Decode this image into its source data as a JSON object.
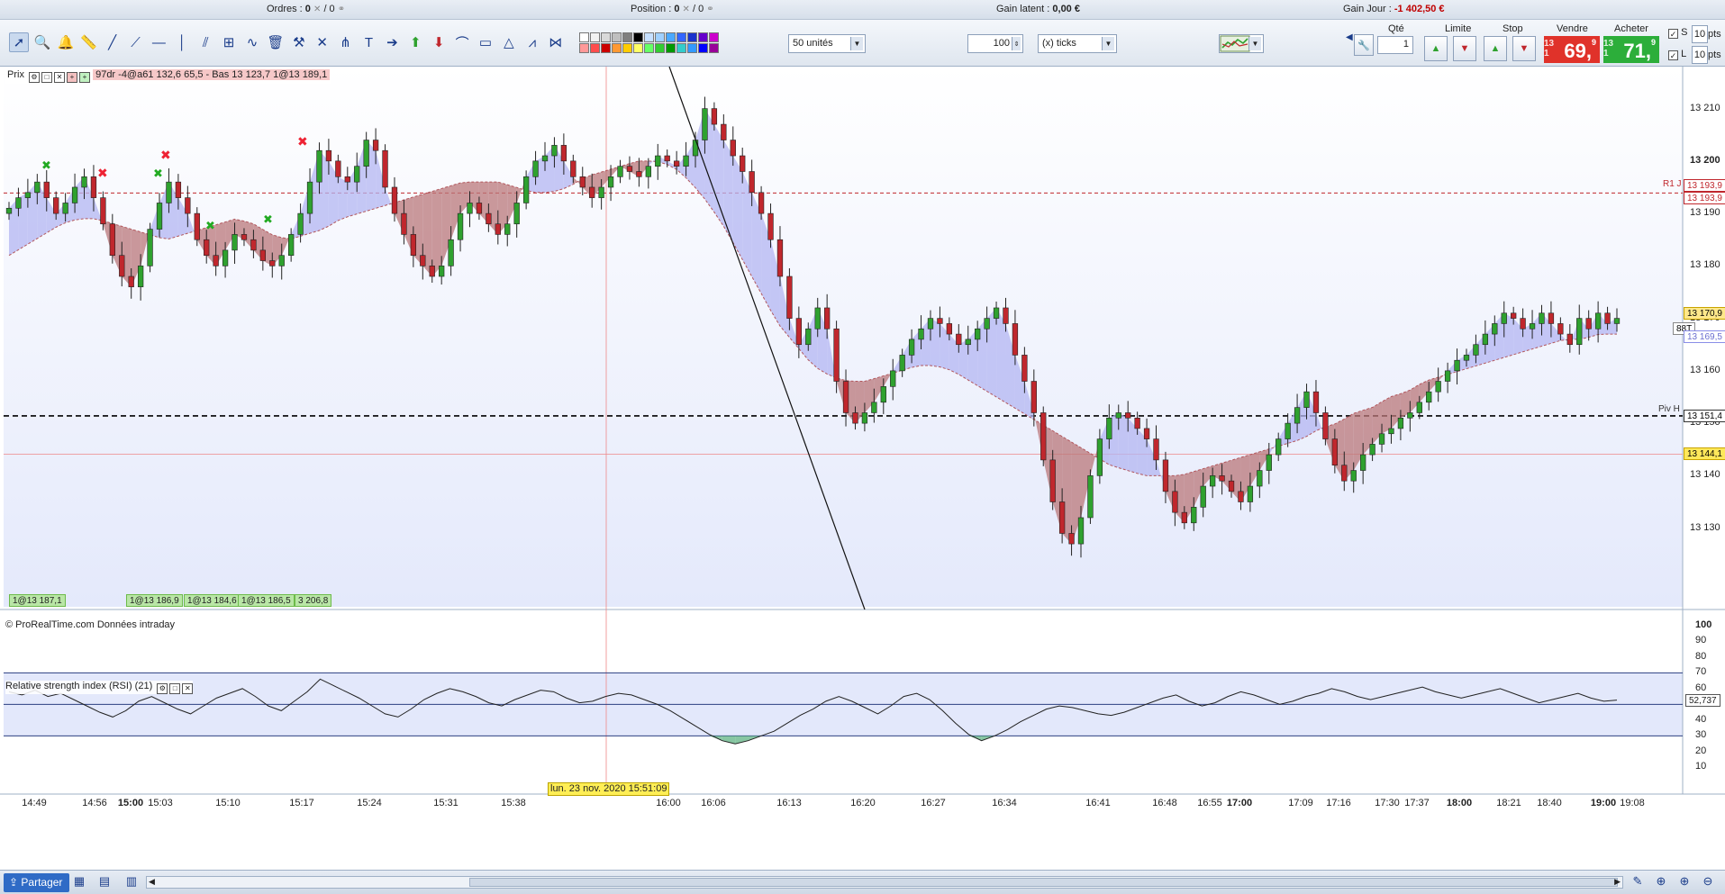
{
  "status": {
    "orders_label": "Ordres :",
    "orders_val1": "0",
    "orders_val2": "/ 0",
    "position_label": "Position :",
    "position_val1": "0",
    "position_val2": "/ 0",
    "gain_latent_label": "Gain latent :",
    "gain_latent_val": "0,00 €",
    "gain_jour_label": "Gain Jour :",
    "gain_jour_val": "-1 402,50 €"
  },
  "toolbar": {
    "units_select": "50 unités",
    "ticks_value": "100",
    "ticks_select": "(x) ticks",
    "tools": [
      "pointer-icon",
      "zoom-icon",
      "alert-bell-icon",
      "ruler-icon",
      "trendline-icon",
      "ray-icon",
      "horizontal-line-icon",
      "vertical-line-icon",
      "parallel-channel-icon",
      "fibonacci-icon",
      "wave-icon",
      "trash-icon",
      "hammer-icon",
      "cross-line-icon",
      "andrews-fork-icon",
      "text-icon",
      "arrow-right-icon",
      "arrow-up-icon",
      "arrow-down-icon",
      "polyline-icon",
      "rectangle-icon",
      "triangle-icon",
      "gann-icon",
      "pattern-icon"
    ]
  },
  "order_panel": {
    "qty_label": "Qté",
    "qty_value": "1",
    "limit_label": "Limite",
    "stop_label": "Stop",
    "sell_label": "Vendre",
    "buy_label": "Acheter",
    "sell_small": "13 1",
    "sell_big": "69,",
    "sell_sup": "9",
    "buy_small": "13 1",
    "buy_big": "71,",
    "buy_sup": "9",
    "s_label": "S",
    "l_label": "L",
    "s_pts": "10",
    "l_pts": "10",
    "pts_unit": "pts"
  },
  "price_panel": {
    "label": "Prix",
    "info": "97dr  -4@a61 132,6 65,5 - Bas 13 123,7 1@13 189,1",
    "watermark": "© ProRealTime.com Données intraday",
    "bottom_tags": [
      "1@13 187,1",
      "1@13 186,9",
      "1@13 184,6",
      "1@13 186,5",
      "3 206,8"
    ],
    "r1_label": "R1 J",
    "piv_label": "Piv H",
    "price_tags": [
      "13 193,9",
      "13 193,9",
      "13 170,9",
      "88T",
      "13 169,5",
      "13 151,4",
      "13 144,1"
    ]
  },
  "rsi_panel": {
    "label": "Relative strength index (RSI) (21)",
    "current": "52,737"
  },
  "colors": {
    "up_candle": "#2fa12f",
    "down_candle": "#c0272d",
    "cloud_red": "#b9777a",
    "cloud_blue": "#b3b5f1",
    "sell_bg": "#e0322a",
    "buy_bg": "#2cae3a",
    "pivot_line": "#000000",
    "r1_line": "#c0272d"
  },
  "cursor_date": "lun. 23 nov. 2020 15:51:09",
  "bottombar": {
    "share": "Partager"
  },
  "chart_data": {
    "type": "candlestick",
    "instrument_unit": "points",
    "price_axis": {
      "ylim": [
        13115,
        13218
      ],
      "ticks": [
        "13 210",
        "13 200",
        "13 190",
        "13 180",
        "13 170",
        "13 160",
        "13 150",
        "13 140",
        "13 130"
      ],
      "bold_ticks": [
        "13 200"
      ]
    },
    "rsi_axis": {
      "ylim": [
        0,
        105
      ],
      "ticks": [
        "100",
        "90",
        "80",
        "70",
        "60",
        "50",
        "40",
        "30",
        "20",
        "10"
      ],
      "bold_ticks": [
        "100"
      ],
      "levels": [
        70,
        50,
        30
      ]
    },
    "x_axis": {
      "ticks": [
        "14:49",
        "14:56",
        "15:00",
        "15:03",
        "15:10",
        "15:17",
        "15:24",
        "15:31",
        "15:38",
        "16:00",
        "16:06",
        "16:13",
        "16:20",
        "16:27",
        "16:34",
        "16:41",
        "16:48",
        "16:55",
        "17:00",
        "17:09",
        "17:16",
        "17:30",
        "17:37",
        "18:00",
        "18:21",
        "18:40",
        "19:00",
        "19:08"
      ],
      "bold_ticks": [
        "15:00",
        "17:00",
        "18:00",
        "19:00"
      ]
    },
    "close_path": [
      13191,
      13193,
      13194,
      13196,
      13193,
      13190,
      13192,
      13195,
      13197,
      13193,
      13188,
      13182,
      13178,
      13176,
      13180,
      13187,
      13192,
      13196,
      13193,
      13190,
      13185,
      13182,
      13180,
      13183,
      13186,
      13185,
      13183,
      13181,
      13180,
      13182,
      13186,
      13190,
      13196,
      13202,
      13200,
      13197,
      13196,
      13199,
      13204,
      13202,
      13195,
      13190,
      13186,
      13182,
      13180,
      13178,
      13180,
      13185,
      13190,
      13192,
      13190,
      13188,
      13186,
      13188,
      13192,
      13197,
      13200,
      13201,
      13203,
      13200,
      13197,
      13195,
      13193,
      13195,
      13197,
      13199,
      13198,
      13197,
      13199,
      13201,
      13200,
      13199,
      13201,
      13204,
      13210,
      13207,
      13204,
      13201,
      13198,
      13194,
      13190,
      13185,
      13178,
      13170,
      13165,
      13168,
      13172,
      13168,
      13158,
      13152,
      13150,
      13152,
      13154,
      13157,
      13160,
      13163,
      13166,
      13168,
      13170,
      13169,
      13167,
      13165,
      13166,
      13168,
      13170,
      13172,
      13169,
      13163,
      13158,
      13152,
      13143,
      13135,
      13129,
      13127,
      13132,
      13140,
      13147,
      13151,
      13152,
      13151,
      13149,
      13147,
      13143,
      13137,
      13133,
      13131,
      13134,
      13138,
      13140,
      13139,
      13137,
      13135,
      13138,
      13141,
      13144,
      13147,
      13150,
      13153,
      13156,
      13152,
      13147,
      13142,
      13139,
      13141,
      13144,
      13146,
      13148,
      13149,
      13151,
      13152,
      13154,
      13156,
      13158,
      13160,
      13162,
      13163,
      13165,
      13167,
      13169,
      13171,
      13170,
      13168,
      13169,
      13171,
      13169,
      13167,
      13165,
      13170,
      13168,
      13171,
      13169,
      13170
    ],
    "mavg_path": [
      13182,
      13184,
      13186,
      13188,
      13189,
      13189,
      13188,
      13187,
      13186,
      13185,
      13186,
      13187,
      13188,
      13189,
      13188,
      13186,
      13185,
      13186,
      13187,
      13189,
      13190,
      13191,
      13192,
      13193,
      13194,
      13195,
      13196,
      13196,
      13196,
      13195,
      13194,
      13194,
      13195,
      13197,
      13198,
      13199,
      13200,
      13200,
      13199,
      13196,
      13192,
      13187,
      13181,
      13175,
      13169,
      13165,
      13161,
      13159,
      13158,
      13158,
      13159,
      13160,
      13161,
      13161,
      13160,
      13158,
      13156,
      13154,
      13152,
      13150,
      13148,
      13146,
      13144,
      13142,
      13141,
      13140,
      13140,
      13140,
      13141,
      13142,
      13143,
      13144,
      13145,
      13146,
      13147,
      13149,
      13150,
      13152,
      13153,
      13155,
      13156,
      13158,
      13159,
      13160,
      13161,
      13162,
      13163,
      13164,
      13165,
      13166,
      13166,
      13167,
      13167
    ],
    "rsi_path": [
      58,
      56,
      59,
      55,
      57,
      53,
      49,
      45,
      42,
      46,
      52,
      55,
      51,
      47,
      44,
      49,
      54,
      57,
      60,
      55,
      49,
      46,
      52,
      58,
      66,
      62,
      58,
      54,
      49,
      44,
      42,
      47,
      53,
      57,
      60,
      58,
      55,
      51,
      49,
      53,
      56,
      59,
      58,
      54,
      51,
      52,
      55,
      57,
      56,
      53,
      50,
      46,
      41,
      36,
      31,
      27,
      25,
      27,
      30,
      33,
      38,
      43,
      47,
      52,
      55,
      52,
      48,
      44,
      49,
      55,
      57,
      53,
      46,
      38,
      31,
      27,
      30,
      34,
      39,
      43,
      47,
      49,
      48,
      46,
      44,
      43,
      45,
      48,
      51,
      54,
      56,
      52,
      49,
      51,
      55,
      58,
      56,
      53,
      50,
      52,
      55,
      57,
      60,
      58,
      55,
      53,
      55,
      57,
      59,
      61,
      58,
      56,
      54,
      56,
      58,
      60,
      57,
      54,
      51,
      53,
      55,
      57,
      54,
      52,
      52.7
    ]
  }
}
